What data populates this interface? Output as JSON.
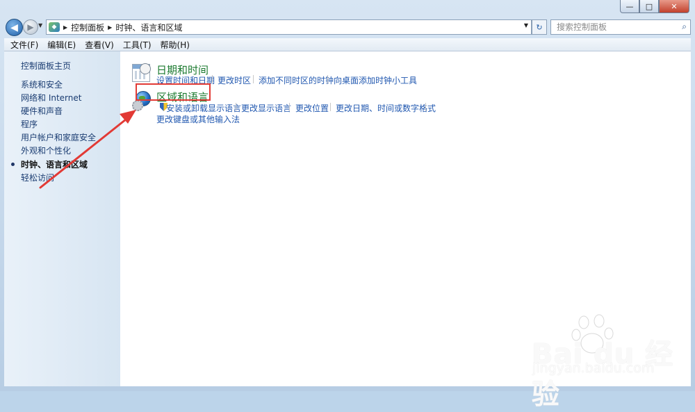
{
  "window": {
    "controls": {
      "minimize": "—",
      "maximize": "□",
      "close": "✕"
    }
  },
  "address_bar": {
    "breadcrumbs": [
      "控制面板",
      "时钟、语言和区域"
    ],
    "search_placeholder": "搜索控制面板"
  },
  "menu": [
    "文件(F)",
    "编辑(E)",
    "查看(V)",
    "工具(T)",
    "帮助(H)"
  ],
  "sidebar": {
    "home": "控制面板主页",
    "items": [
      "系统和安全",
      "网络和 Internet",
      "硬件和声音",
      "程序",
      "用户帐户和家庭安全",
      "外观和个性化",
      "时钟、语言和区域",
      "轻松访问"
    ],
    "active_index": 6
  },
  "sections": [
    {
      "title": "日期和时间",
      "icon": "calendar-clock-icon",
      "links": [
        "设置时间和日期",
        "更改时区",
        "添加不同时区的时钟",
        "向桌面添加时钟小工具"
      ]
    },
    {
      "title": "区域和语言",
      "icon": "globe-icon",
      "links": [
        "安装或卸载显示语言",
        "更改显示语言",
        "更改位置",
        "更改日期、时间或数字格式",
        "更改键盘或其他输入法"
      ]
    }
  ],
  "annotation": {
    "color": "#e23a35"
  },
  "watermark": {
    "logo": "Bai du 经验",
    "url": "jingyan.baidu.com"
  },
  "colors": {
    "section_title": "#1b7a2f",
    "link": "#2158b0",
    "sidebar_link": "#1b3d72"
  }
}
